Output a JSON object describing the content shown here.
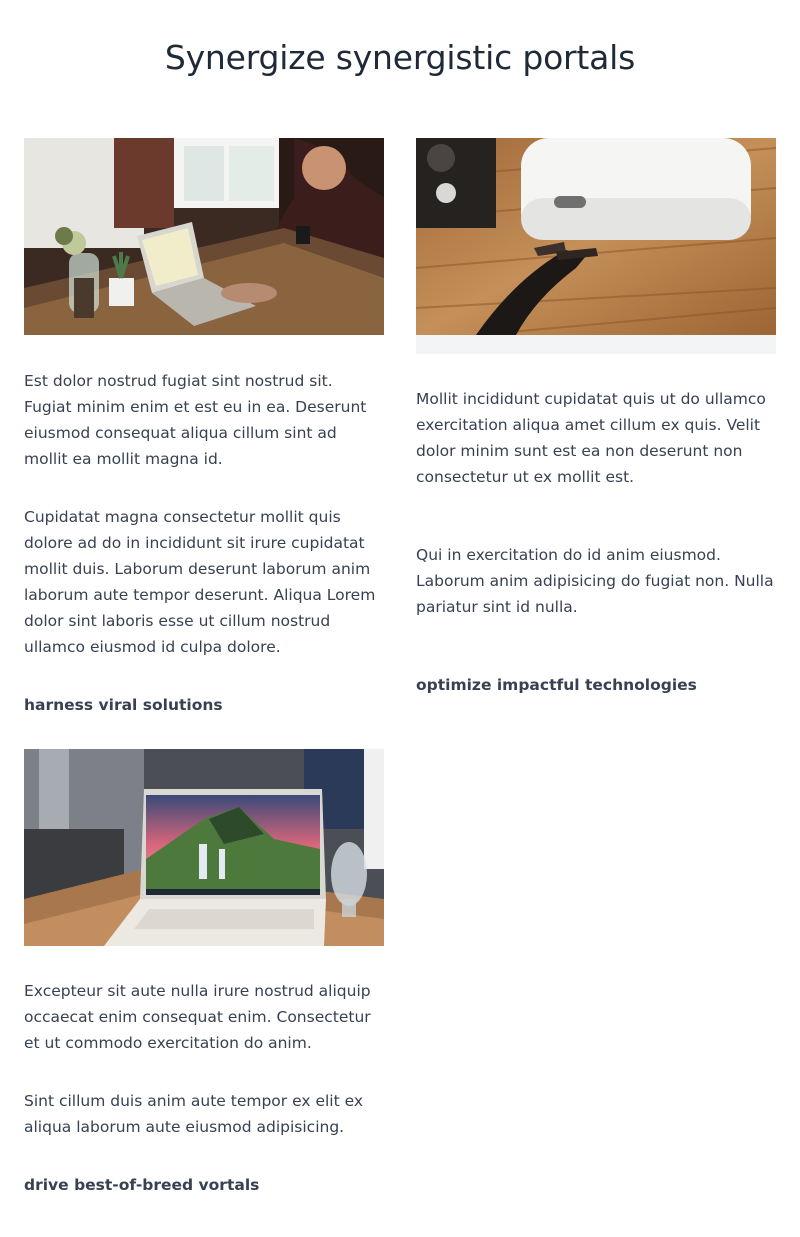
{
  "page": {
    "title": "Synergize synergistic portals"
  },
  "cards": [
    {
      "image": "man typing on laptop at wooden desk with plants",
      "paragraphs": [
        "Est dolor nostrud fugiat sint nostrud sit. Fugiat minim enim et est eu in ea. Deserunt eiusmod consequat aliqua cillum sint ad mollit ea mollit magna id.",
        "Cupidatat magna consectetur mollit quis dolore ad do in incididunt sit irure cupidatat mollit duis. Laborum deserunt laborum anim laborum aute tempor deserunt. Aliqua Lorem dolor sint laboris esse ut cillum nostrud ullamco eiusmod id culpa dolore."
      ],
      "link": "harness viral solutions"
    },
    {
      "image": "white earbuds charging case on wooden table",
      "paragraphs": [
        "Mollit incididunt cupidatat quis ut do ullamco exercitation aliqua amet cillum ex quis. Velit dolor minim sunt est ea non deserunt non consectetur ut ex mollit est.",
        "Qui in exercitation do id anim eiusmod. Laborum anim adipisicing do fugiat non. Nulla pariatur sint id nulla."
      ],
      "link": "optimize impactful technologies"
    },
    {
      "image": "white laptop showing waterfall landscape wallpaper",
      "paragraphs": [
        "Excepteur sit aute nulla irure nostrud aliquip occaecat enim consequat enim. Consectetur et ut commodo exercitation do anim.",
        "Sint cillum duis anim aute tempor ex elit ex aliqua laborum aute eiusmod adipisicing."
      ],
      "link": "drive best-of-breed vortals"
    }
  ]
}
